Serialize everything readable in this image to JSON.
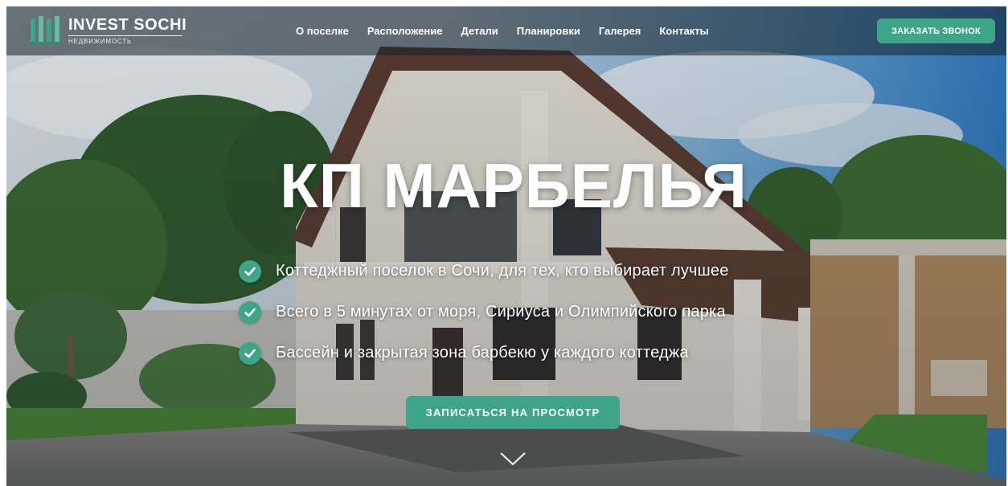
{
  "brand": {
    "name": "INVEST SOCHI",
    "subtitle": "НЕДВИЖИМОСТЬ"
  },
  "nav": {
    "items": [
      {
        "label": "О поселке"
      },
      {
        "label": "Расположение"
      },
      {
        "label": "Детали"
      },
      {
        "label": "Планировки"
      },
      {
        "label": "Галерея"
      },
      {
        "label": "Контакты"
      }
    ]
  },
  "header": {
    "cta_label": "ЗАКАЗАТЬ ЗВОНОК"
  },
  "hero": {
    "title": "КП МАРБЕЛЬЯ",
    "features": [
      {
        "text": "Коттеджный поселок в Сочи, для тех, кто выбирает лучшее"
      },
      {
        "text": "Всего в 5 минутах от моря, Сириуса и Олимпийского парка"
      },
      {
        "text": "Бассейн и закрытая зона барбекю у каждого коттеджа"
      }
    ],
    "cta_label": "ЗАПИСАТЬСЯ НА ПРОСМОТР"
  },
  "colors": {
    "accent": "#3fa589",
    "header_bg": "#18222a"
  },
  "icons": {
    "logo": "logo-bars-icon",
    "check": "check-circle-icon",
    "scroll": "chevron-down-icon"
  }
}
